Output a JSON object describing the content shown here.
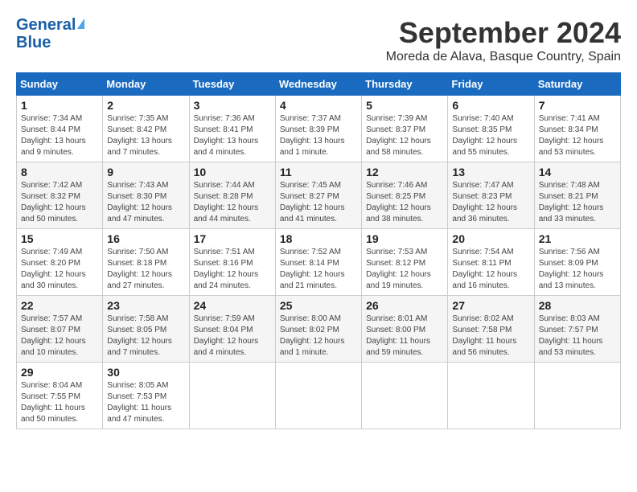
{
  "header": {
    "logo_general": "General",
    "logo_blue": "Blue",
    "month_title": "September 2024",
    "location": "Moreda de Alava, Basque Country, Spain"
  },
  "days_of_week": [
    "Sunday",
    "Monday",
    "Tuesday",
    "Wednesday",
    "Thursday",
    "Friday",
    "Saturday"
  ],
  "weeks": [
    [
      {
        "day": "1",
        "info": "Sunrise: 7:34 AM\nSunset: 8:44 PM\nDaylight: 13 hours\nand 9 minutes."
      },
      {
        "day": "2",
        "info": "Sunrise: 7:35 AM\nSunset: 8:42 PM\nDaylight: 13 hours\nand 7 minutes."
      },
      {
        "day": "3",
        "info": "Sunrise: 7:36 AM\nSunset: 8:41 PM\nDaylight: 13 hours\nand 4 minutes."
      },
      {
        "day": "4",
        "info": "Sunrise: 7:37 AM\nSunset: 8:39 PM\nDaylight: 13 hours\nand 1 minute."
      },
      {
        "day": "5",
        "info": "Sunrise: 7:39 AM\nSunset: 8:37 PM\nDaylight: 12 hours\nand 58 minutes."
      },
      {
        "day": "6",
        "info": "Sunrise: 7:40 AM\nSunset: 8:35 PM\nDaylight: 12 hours\nand 55 minutes."
      },
      {
        "day": "7",
        "info": "Sunrise: 7:41 AM\nSunset: 8:34 PM\nDaylight: 12 hours\nand 53 minutes."
      }
    ],
    [
      {
        "day": "8",
        "info": "Sunrise: 7:42 AM\nSunset: 8:32 PM\nDaylight: 12 hours\nand 50 minutes."
      },
      {
        "day": "9",
        "info": "Sunrise: 7:43 AM\nSunset: 8:30 PM\nDaylight: 12 hours\nand 47 minutes."
      },
      {
        "day": "10",
        "info": "Sunrise: 7:44 AM\nSunset: 8:28 PM\nDaylight: 12 hours\nand 44 minutes."
      },
      {
        "day": "11",
        "info": "Sunrise: 7:45 AM\nSunset: 8:27 PM\nDaylight: 12 hours\nand 41 minutes."
      },
      {
        "day": "12",
        "info": "Sunrise: 7:46 AM\nSunset: 8:25 PM\nDaylight: 12 hours\nand 38 minutes."
      },
      {
        "day": "13",
        "info": "Sunrise: 7:47 AM\nSunset: 8:23 PM\nDaylight: 12 hours\nand 36 minutes."
      },
      {
        "day": "14",
        "info": "Sunrise: 7:48 AM\nSunset: 8:21 PM\nDaylight: 12 hours\nand 33 minutes."
      }
    ],
    [
      {
        "day": "15",
        "info": "Sunrise: 7:49 AM\nSunset: 8:20 PM\nDaylight: 12 hours\nand 30 minutes."
      },
      {
        "day": "16",
        "info": "Sunrise: 7:50 AM\nSunset: 8:18 PM\nDaylight: 12 hours\nand 27 minutes."
      },
      {
        "day": "17",
        "info": "Sunrise: 7:51 AM\nSunset: 8:16 PM\nDaylight: 12 hours\nand 24 minutes."
      },
      {
        "day": "18",
        "info": "Sunrise: 7:52 AM\nSunset: 8:14 PM\nDaylight: 12 hours\nand 21 minutes."
      },
      {
        "day": "19",
        "info": "Sunrise: 7:53 AM\nSunset: 8:12 PM\nDaylight: 12 hours\nand 19 minutes."
      },
      {
        "day": "20",
        "info": "Sunrise: 7:54 AM\nSunset: 8:11 PM\nDaylight: 12 hours\nand 16 minutes."
      },
      {
        "day": "21",
        "info": "Sunrise: 7:56 AM\nSunset: 8:09 PM\nDaylight: 12 hours\nand 13 minutes."
      }
    ],
    [
      {
        "day": "22",
        "info": "Sunrise: 7:57 AM\nSunset: 8:07 PM\nDaylight: 12 hours\nand 10 minutes."
      },
      {
        "day": "23",
        "info": "Sunrise: 7:58 AM\nSunset: 8:05 PM\nDaylight: 12 hours\nand 7 minutes."
      },
      {
        "day": "24",
        "info": "Sunrise: 7:59 AM\nSunset: 8:04 PM\nDaylight: 12 hours\nand 4 minutes."
      },
      {
        "day": "25",
        "info": "Sunrise: 8:00 AM\nSunset: 8:02 PM\nDaylight: 12 hours\nand 1 minute."
      },
      {
        "day": "26",
        "info": "Sunrise: 8:01 AM\nSunset: 8:00 PM\nDaylight: 11 hours\nand 59 minutes."
      },
      {
        "day": "27",
        "info": "Sunrise: 8:02 AM\nSunset: 7:58 PM\nDaylight: 11 hours\nand 56 minutes."
      },
      {
        "day": "28",
        "info": "Sunrise: 8:03 AM\nSunset: 7:57 PM\nDaylight: 11 hours\nand 53 minutes."
      }
    ],
    [
      {
        "day": "29",
        "info": "Sunrise: 8:04 AM\nSunset: 7:55 PM\nDaylight: 11 hours\nand 50 minutes."
      },
      {
        "day": "30",
        "info": "Sunrise: 8:05 AM\nSunset: 7:53 PM\nDaylight: 11 hours\nand 47 minutes."
      },
      {
        "day": "",
        "info": ""
      },
      {
        "day": "",
        "info": ""
      },
      {
        "day": "",
        "info": ""
      },
      {
        "day": "",
        "info": ""
      },
      {
        "day": "",
        "info": ""
      }
    ]
  ]
}
